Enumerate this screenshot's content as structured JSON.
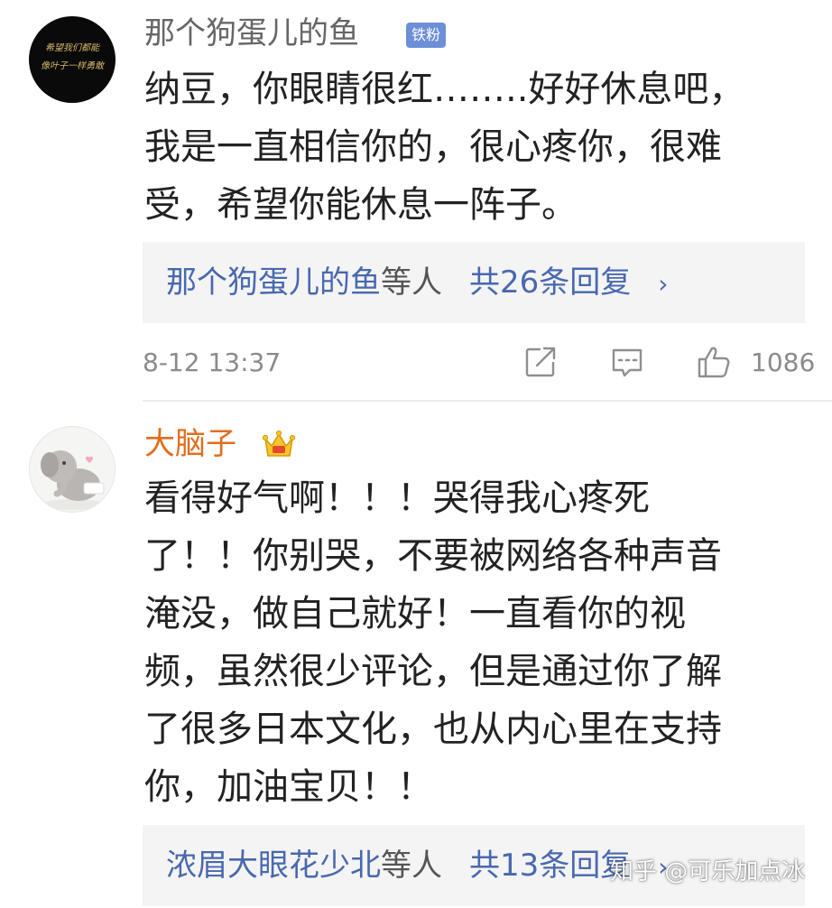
{
  "comments": [
    {
      "username": "那个狗蛋儿的鱼",
      "badge": "铁粉",
      "avatar_text": [
        "希望我们都能",
        "像叶子一样勇敢"
      ],
      "lines": [
        "纳豆，你眼睛很红……..好好休息吧，",
        "我是一直相信你的，很心疼你，很难",
        "受，希望你能休息一阵子。"
      ],
      "reply_summary": {
        "names": "那个狗蛋儿的鱼",
        "others": "等人",
        "count": "共26条回复",
        "chevron": "›"
      },
      "timestamp": "8-12  13:37",
      "like_count": "1086"
    },
    {
      "username": "大脑子",
      "lines": [
        "看得好气啊！！！哭得我心疼死",
        "了！！你别哭，不要被网络各种声音",
        "淹没，做自己就好！一直看你的视",
        "频，虽然很少评论，但是通过你了解",
        "了很多日本文化，也从内心里在支持",
        "你，加油宝贝！！"
      ],
      "reply_summary": {
        "names": "浓眉大眼花少北",
        "others": "等人",
        "count": "共13条回复",
        "chevron": "›"
      }
    }
  ],
  "watermark": "知乎 @可乐加点冰",
  "colors": {
    "username_gray": "#666666",
    "username_orange": "#e26d1b",
    "link_blue": "#4868b0",
    "badge_blue": "#6c8fd8",
    "reply_bg": "#f4f4f4",
    "meta_gray": "#8a8a8a"
  },
  "icons": [
    "share-icon",
    "reply-icon",
    "like-icon",
    "crown-icon"
  ]
}
